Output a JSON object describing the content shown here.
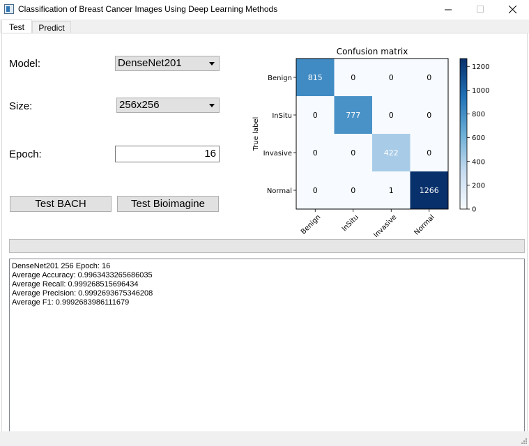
{
  "window": {
    "title": "Classification of Breast Cancer Images Using Deep Learning Methods"
  },
  "tabs": [
    {
      "label": "Test",
      "active": true
    },
    {
      "label": "Predict",
      "active": false
    }
  ],
  "form": {
    "model_label": "Model:",
    "model_value": "DenseNet201",
    "size_label": "Size:",
    "size_value": "256x256",
    "epoch_label": "Epoch:",
    "epoch_value": "16",
    "test_bach_label": "Test BACH",
    "test_bioimagine_label": "Test Bioimagine"
  },
  "chart_data": {
    "type": "heatmap",
    "title": "Confusion matrix",
    "ylabel": "True label",
    "xlabel": "",
    "labels": [
      "Benign",
      "InSitu",
      "Invasive",
      "Normal"
    ],
    "matrix": [
      [
        815,
        0,
        0,
        0
      ],
      [
        0,
        777,
        0,
        0
      ],
      [
        0,
        0,
        422,
        0
      ],
      [
        0,
        0,
        1,
        1266
      ]
    ],
    "colorbar": {
      "min": 0,
      "max": 1266,
      "ticks": [
        0,
        200,
        400,
        600,
        800,
        1000,
        1200
      ],
      "colormap": "Blues"
    }
  },
  "progress": {
    "value": 0
  },
  "output": {
    "lines": [
      "DenseNet201 256 Epoch: 16",
      "Average Accuracy: 0.9963433265686035",
      "Average Recall: 0.999268515696434",
      "Average Precision: 0.9992693675346208",
      "Average F1: 0.9992683986111679"
    ]
  }
}
